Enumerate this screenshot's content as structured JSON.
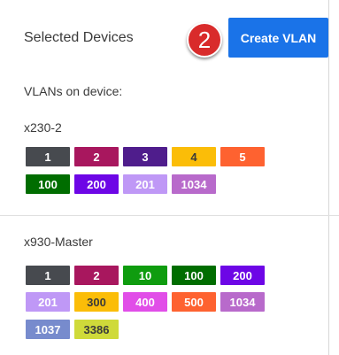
{
  "header": {
    "title": "Selected Devices",
    "step_number": "2",
    "create_vlan_label": "Create VLAN"
  },
  "vlans_label": "VLANs on device:",
  "devices": [
    {
      "name": "x230-2",
      "rows": [
        [
          {
            "label": "1",
            "color": "#474a4f",
            "text": "#ffffff"
          },
          {
            "label": "2",
            "color": "#a8175e",
            "text": "#ffffff"
          },
          {
            "label": "3",
            "color": "#4f1d8c",
            "text": "#ffffff"
          },
          {
            "label": "4",
            "color": "#fbbd08",
            "text": "#3a3a3a"
          },
          {
            "label": "5",
            "color": "#fe6230",
            "text": "#ffffff"
          }
        ],
        [
          {
            "label": "100",
            "color": "#006d00",
            "text": "#ffffff"
          },
          {
            "label": "200",
            "color": "#6d06e6",
            "text": "#ffffff"
          },
          {
            "label": "201",
            "color": "#bf98f6",
            "text": "#ffffff"
          },
          {
            "label": "1034",
            "color": "#b86acb",
            "text": "#ffffff"
          }
        ]
      ]
    },
    {
      "name": "x930-Master",
      "rows": [
        [
          {
            "label": "1",
            "color": "#474a4f",
            "text": "#ffffff"
          },
          {
            "label": "2",
            "color": "#a8175e",
            "text": "#ffffff"
          },
          {
            "label": "10",
            "color": "#0f9c0f",
            "text": "#ffffff"
          },
          {
            "label": "100",
            "color": "#006d00",
            "text": "#ffffff"
          },
          {
            "label": "200",
            "color": "#6d06e6",
            "text": "#ffffff"
          }
        ],
        [
          {
            "label": "201",
            "color": "#bf98f6",
            "text": "#ffffff"
          },
          {
            "label": "300",
            "color": "#fbbd08",
            "text": "#3a3a3a"
          },
          {
            "label": "400",
            "color": "#e14ee8",
            "text": "#ffffff"
          },
          {
            "label": "500",
            "color": "#fe6230",
            "text": "#ffffff"
          },
          {
            "label": "1034",
            "color": "#b86acb",
            "text": "#ffffff"
          }
        ],
        [
          {
            "label": "1037",
            "color": "#778bcd",
            "text": "#ffffff"
          },
          {
            "label": "3386",
            "color": "#cfda3a",
            "text": "#3a3a3a"
          }
        ]
      ]
    }
  ]
}
